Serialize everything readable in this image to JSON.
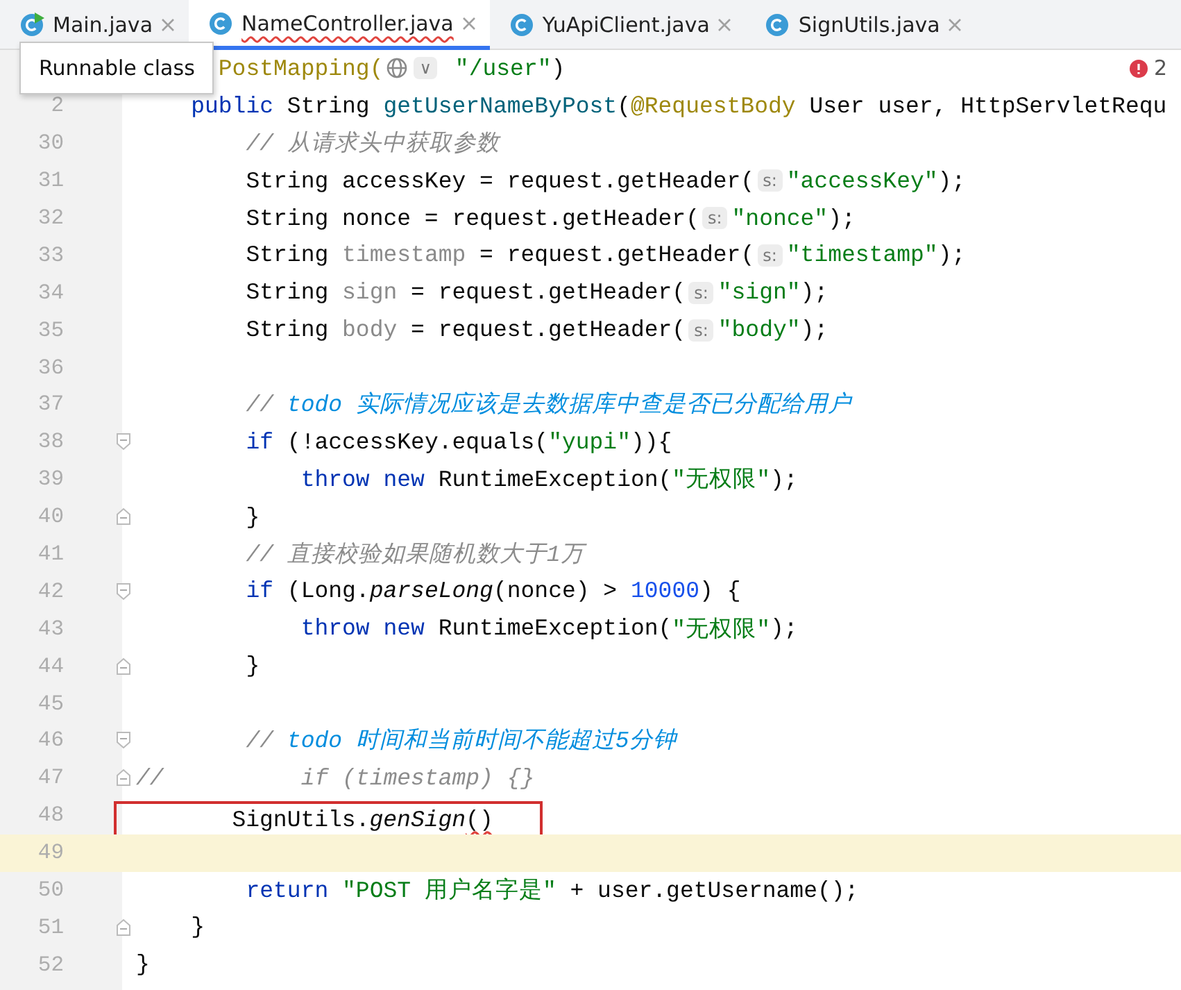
{
  "tabs": [
    {
      "label": "Main.java",
      "selected": false,
      "runnable": true,
      "error": false
    },
    {
      "label": "NameController.java",
      "selected": true,
      "runnable": false,
      "error": true
    },
    {
      "label": "YuApiClient.java",
      "selected": false,
      "runnable": false,
      "error": false
    },
    {
      "label": "SignUtils.java",
      "selected": false,
      "runnable": false,
      "error": false
    }
  ],
  "tooltip": "Runnable class",
  "problems": {
    "count": "2"
  },
  "lines": [
    {
      "current": false,
      "boxed": false,
      "tokens": [
        {
          "kind": "annotation",
          "text": "      PostMapping("
        },
        {
          "kind": "globe"
        },
        {
          "kind": "hint",
          "text": "∨"
        },
        {
          "kind": "string",
          "text": " \"/user\""
        },
        {
          "kind": "plain",
          "text": ")"
        }
      ]
    },
    {
      "number": "2",
      "current": false,
      "boxed": false,
      "tokens": [
        {
          "kind": "keyword",
          "text": "    public "
        },
        {
          "kind": "plain",
          "text": "String "
        },
        {
          "kind": "method",
          "text": "getUserNameByPost"
        },
        {
          "kind": "plain",
          "text": "("
        },
        {
          "kind": "annotation",
          "text": "@RequestBody "
        },
        {
          "kind": "plain",
          "text": "User user, HttpServletRequ"
        }
      ]
    },
    {
      "number": "30",
      "current": false,
      "boxed": false,
      "tokens": [
        {
          "kind": "comment",
          "text": "        // 从请求头中获取参数"
        }
      ]
    },
    {
      "number": "31",
      "current": false,
      "boxed": false,
      "tokens": [
        {
          "kind": "plain",
          "text": "        String accessKey = request.getHeader("
        },
        {
          "kind": "hint",
          "text": "s:"
        },
        {
          "kind": "string",
          "text": "\"accessKey\""
        },
        {
          "kind": "plain",
          "text": ");"
        }
      ]
    },
    {
      "number": "32",
      "current": false,
      "boxed": false,
      "tokens": [
        {
          "kind": "plain",
          "text": "        String nonce = request.getHeader("
        },
        {
          "kind": "hint",
          "text": "s:"
        },
        {
          "kind": "string",
          "text": "\"nonce\""
        },
        {
          "kind": "plain",
          "text": ");"
        }
      ]
    },
    {
      "number": "33",
      "current": false,
      "boxed": false,
      "tokens": [
        {
          "kind": "plain",
          "text": "        String "
        },
        {
          "kind": "unused",
          "text": "timestamp"
        },
        {
          "kind": "plain",
          "text": " = request.getHeader("
        },
        {
          "kind": "hint",
          "text": "s:"
        },
        {
          "kind": "string",
          "text": "\"timestamp\""
        },
        {
          "kind": "plain",
          "text": ");"
        }
      ]
    },
    {
      "number": "34",
      "current": false,
      "boxed": false,
      "tokens": [
        {
          "kind": "plain",
          "text": "        String "
        },
        {
          "kind": "unused",
          "text": "sign"
        },
        {
          "kind": "plain",
          "text": " = request.getHeader("
        },
        {
          "kind": "hint",
          "text": "s:"
        },
        {
          "kind": "string",
          "text": "\"sign\""
        },
        {
          "kind": "plain",
          "text": ");"
        }
      ]
    },
    {
      "number": "35",
      "current": false,
      "boxed": false,
      "tokens": [
        {
          "kind": "plain",
          "text": "        String "
        },
        {
          "kind": "unused",
          "text": "body"
        },
        {
          "kind": "plain",
          "text": " = request.getHeader("
        },
        {
          "kind": "hint",
          "text": "s:"
        },
        {
          "kind": "string",
          "text": "\"body\""
        },
        {
          "kind": "plain",
          "text": ");"
        }
      ]
    },
    {
      "number": "36",
      "current": false,
      "boxed": false
    },
    {
      "number": "37",
      "current": false,
      "boxed": false,
      "tokens": [
        {
          "kind": "comment",
          "text": "        // "
        },
        {
          "kind": "todo",
          "text": "todo 实际情况应该是去数据库中查是否已分配给用户"
        }
      ]
    },
    {
      "number": "38",
      "fold": {
        "kind": "start"
      },
      "current": false,
      "boxed": false,
      "tokens": [
        {
          "kind": "keyword",
          "text": "        if "
        },
        {
          "kind": "plain",
          "text": "(!accessKey.equals("
        },
        {
          "kind": "string",
          "text": "\"yupi\""
        },
        {
          "kind": "plain",
          "text": ")){"
        }
      ]
    },
    {
      "number": "39",
      "current": false,
      "boxed": false,
      "tokens": [
        {
          "kind": "keyword",
          "text": "            throw new "
        },
        {
          "kind": "plain",
          "text": "RuntimeException("
        },
        {
          "kind": "string",
          "text": "\"无权限\""
        },
        {
          "kind": "plain",
          "text": ");"
        }
      ]
    },
    {
      "number": "40",
      "fold": {
        "kind": "end"
      },
      "current": false,
      "boxed": false,
      "tokens": [
        {
          "kind": "plain",
          "text": "        }"
        }
      ]
    },
    {
      "number": "41",
      "current": false,
      "boxed": false,
      "tokens": [
        {
          "kind": "comment",
          "text": "        // 直接校验如果随机数大于1万"
        }
      ]
    },
    {
      "number": "42",
      "fold": {
        "kind": "start"
      },
      "current": false,
      "boxed": false,
      "tokens": [
        {
          "kind": "keyword",
          "text": "        if "
        },
        {
          "kind": "plain",
          "text": "(Long."
        },
        {
          "kind": "static",
          "text": "parseLong"
        },
        {
          "kind": "plain",
          "text": "(nonce) > "
        },
        {
          "kind": "number",
          "text": "10000"
        },
        {
          "kind": "plain",
          "text": ") {"
        }
      ]
    },
    {
      "number": "43",
      "current": false,
      "boxed": false,
      "tokens": [
        {
          "kind": "keyword",
          "text": "            throw new "
        },
        {
          "kind": "plain",
          "text": "RuntimeException("
        },
        {
          "kind": "string",
          "text": "\"无权限\""
        },
        {
          "kind": "plain",
          "text": ");"
        }
      ]
    },
    {
      "number": "44",
      "fold": {
        "kind": "end"
      },
      "current": false,
      "boxed": false,
      "tokens": [
        {
          "kind": "plain",
          "text": "        }"
        }
      ]
    },
    {
      "number": "45",
      "current": false,
      "boxed": false
    },
    {
      "number": "46",
      "fold": {
        "kind": "start"
      },
      "current": false,
      "boxed": false,
      "tokens": [
        {
          "kind": "comment",
          "text": "        // "
        },
        {
          "kind": "todo",
          "text": "todo 时间和当前时间不能超过5分钟"
        }
      ]
    },
    {
      "number": "47",
      "fold": {
        "kind": "end"
      },
      "current": false,
      "boxed": false,
      "tokens": [
        {
          "kind": "comment",
          "text": "//          if (timestamp) {}"
        }
      ]
    },
    {
      "number": "48",
      "current": false,
      "boxed": true,
      "tokens": [
        {
          "kind": "plain",
          "text": "        SignUtils."
        },
        {
          "kind": "static",
          "text": "genSign"
        },
        {
          "kind": "error",
          "text": "()"
        }
      ]
    },
    {
      "number": "49",
      "current": true,
      "boxed": false
    },
    {
      "number": "50",
      "current": false,
      "boxed": false,
      "tokens": [
        {
          "kind": "keyword",
          "text": "        return "
        },
        {
          "kind": "string",
          "text": "\"POST 用户名字是\""
        },
        {
          "kind": "plain",
          "text": " + user.getUsername();"
        }
      ]
    },
    {
      "number": "51",
      "fold": {
        "kind": "end"
      },
      "current": false,
      "boxed": false,
      "tokens": [
        {
          "kind": "plain",
          "text": "    }"
        }
      ]
    },
    {
      "number": "52",
      "current": false,
      "boxed": false,
      "tokens": [
        {
          "kind": "plain",
          "text": "}"
        }
      ]
    }
  ]
}
